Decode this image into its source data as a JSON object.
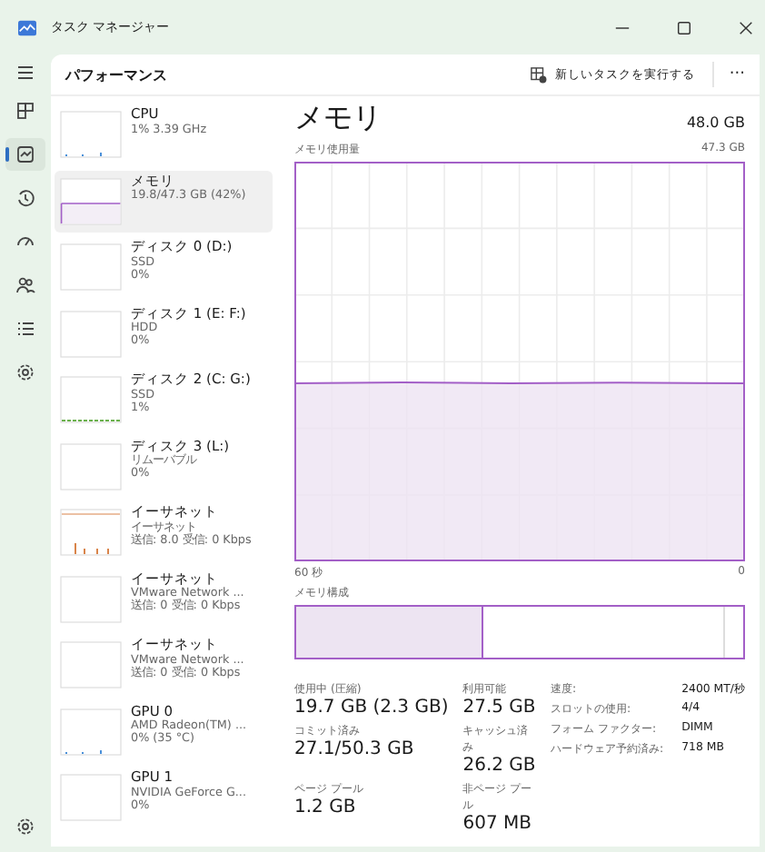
{
  "window": {
    "title": "タスク マネージャー"
  },
  "nav": [
    {
      "kind": "processes",
      "selected": false
    },
    {
      "kind": "performance",
      "selected": true
    },
    {
      "kind": "history",
      "selected": false
    },
    {
      "kind": "startup",
      "selected": false
    },
    {
      "kind": "users",
      "selected": false
    },
    {
      "kind": "details",
      "selected": false
    },
    {
      "kind": "services",
      "selected": false
    }
  ],
  "header": {
    "title": "パフォーマンス",
    "run_task": "新しいタスクを実行する",
    "more": "···"
  },
  "sidebar": {
    "items": [
      {
        "name": "CPU",
        "line2": "1%  3.39 GHz",
        "selected": false,
        "kind": "dots"
      },
      {
        "name": "メモリ",
        "line2": "19.8/47.3 GB (42%)",
        "selected": true,
        "kind": "fill"
      },
      {
        "name": "ディスク 0 (D:)",
        "line2": "SSD",
        "line3": "0%",
        "selected": false,
        "kind": "none"
      },
      {
        "name": "ディスク 1 (E: F:)",
        "line2": "HDD",
        "line3": "0%",
        "selected": false,
        "kind": "none"
      },
      {
        "name": "ディスク 2 (C: G:)",
        "line2": "SSD",
        "line3": "1%",
        "selected": false,
        "kind": "base"
      },
      {
        "name": "ディスク 3 (L:)",
        "line2": "リムーバブル",
        "line3": "0%",
        "selected": false,
        "kind": "none"
      },
      {
        "name": "イーサネット",
        "line2": "イーサネット",
        "line3": "送信: 8.0 受信: 0 Kbps",
        "selected": false,
        "kind": "spikes"
      },
      {
        "name": "イーサネット",
        "line2": "VMware Network ...",
        "line3": "送信: 0 受信: 0 Kbps",
        "selected": false,
        "kind": "none"
      },
      {
        "name": "イーサネット",
        "line2": "VMware Network ...",
        "line3": "送信: 0 受信: 0 Kbps",
        "selected": false,
        "kind": "none"
      },
      {
        "name": "GPU 0",
        "line2": "AMD Radeon(TM) ...",
        "line3": "0%  (35 °C)",
        "selected": false,
        "kind": "dots"
      },
      {
        "name": "GPU 1",
        "line2": "NVIDIA GeForce G...",
        "line3": "0%",
        "selected": false,
        "kind": "none"
      }
    ]
  },
  "detail": {
    "title": "メモリ",
    "total": "48.0 GB",
    "graph_label": "メモリ使用量",
    "graph_max": "47.3 GB",
    "x_start": "60 秒",
    "x_end": "0",
    "composition_label": "メモリ構成",
    "composition": {
      "level": 0.42
    },
    "stats": [
      {
        "label": "使用中 (圧縮)",
        "value": "19.7 GB (2.3 GB)"
      },
      {
        "label": "利用可能",
        "value": "27.5 GB"
      },
      {
        "label": "コミット済み",
        "value": "27.1/50.3 GB"
      },
      {
        "label": "キャッシュ済み",
        "value": "26.2 GB"
      },
      {
        "label": "ページ プール",
        "value": "1.2 GB"
      },
      {
        "label": "非ページ プール",
        "value": "607 MB"
      }
    ],
    "properties": [
      {
        "label": "速度:",
        "value": "2400 MT/秒"
      },
      {
        "label": "スロットの使用:",
        "value": "4/4"
      },
      {
        "label": "フォーム ファクター:",
        "value": "DIMM"
      },
      {
        "label": "ハードウェア予約済み:",
        "value": "718 MB"
      }
    ]
  }
}
